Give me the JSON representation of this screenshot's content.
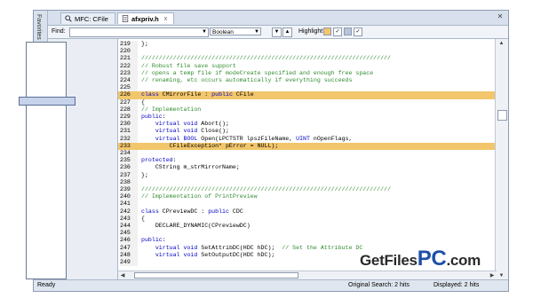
{
  "tabs": [
    {
      "label": "MFC: CFile",
      "icon": "search-icon"
    },
    {
      "label": "afxpriv.h",
      "icon": "document-icon",
      "close": "x"
    }
  ],
  "side_strip_label": "Favorites",
  "find_bar": {
    "label": "Find:",
    "value": "",
    "mode": "Boolean",
    "highlight_label": "Highlight:",
    "highlight_colors": [
      "#f2c66b",
      "#b9c3d9"
    ]
  },
  "code_lines": [
    {
      "n": "219",
      "text": "};"
    },
    {
      "n": "220",
      "text": ""
    },
    {
      "n": "221",
      "text": "///////////////////////////////////////////////////////////////////////"
    },
    {
      "n": "222",
      "text": "// Robust file save support"
    },
    {
      "n": "223",
      "text": "// opens a temp file if modeCreate specified and enough free space"
    },
    {
      "n": "224",
      "text": "// renaming, etc occurs automatically if everything succeeds"
    },
    {
      "n": "225",
      "text": ""
    },
    {
      "n": "226",
      "text": "class CMirrorFile : public CFile",
      "highlight": true
    },
    {
      "n": "227",
      "text": "{"
    },
    {
      "n": "228",
      "text": "// Implementation"
    },
    {
      "n": "229",
      "text": "public:"
    },
    {
      "n": "230",
      "text": "    virtual void Abort();"
    },
    {
      "n": "231",
      "text": "    virtual void Close();"
    },
    {
      "n": "232",
      "text": "    virtual BOOL Open(LPCTSTR lpszFileName, UINT nOpenFlags,"
    },
    {
      "n": "233",
      "text": "        CFileException* pError = NULL);",
      "highlight": true
    },
    {
      "n": "234",
      "text": ""
    },
    {
      "n": "235",
      "text": "protected:"
    },
    {
      "n": "236",
      "text": "    CString m_strMirrorName;"
    },
    {
      "n": "237",
      "text": "};"
    },
    {
      "n": "238",
      "text": ""
    },
    {
      "n": "239",
      "text": "///////////////////////////////////////////////////////////////////////"
    },
    {
      "n": "240",
      "text": "// Implementation of PrintPreview"
    },
    {
      "n": "241",
      "text": ""
    },
    {
      "n": "242",
      "text": "class CPreviewDC : public CDC"
    },
    {
      "n": "243",
      "text": "{"
    },
    {
      "n": "244",
      "text": "    DECLARE_DYNAMIC(CPreviewDC)"
    },
    {
      "n": "245",
      "text": ""
    },
    {
      "n": "246",
      "text": "public:"
    },
    {
      "n": "247",
      "text": "    virtual void SetAttribDC(HDC hDC);  // Set the Attribute DC"
    },
    {
      "n": "248",
      "text": "    virtual void SetOutputDC(HDC hDC);"
    },
    {
      "n": "249",
      "text": ""
    }
  ],
  "status": {
    "left": "Ready",
    "original_search": "Original Search: 2 hits",
    "displayed": "Displayed: 2 hits"
  },
  "watermark": {
    "main": "GetFiles",
    "accent": "PC",
    "suffix": ".com"
  }
}
